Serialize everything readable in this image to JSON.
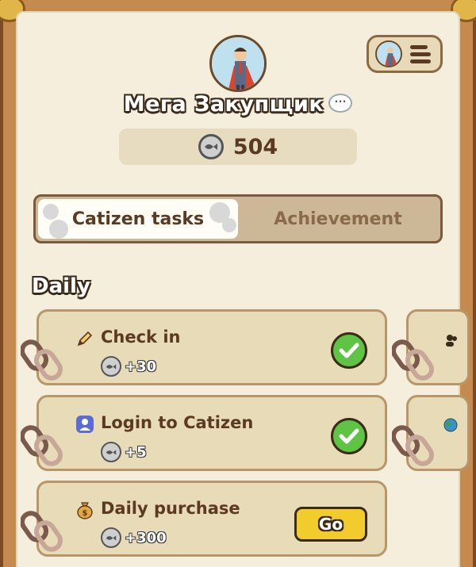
{
  "profile": {
    "username": "Мега Закупщик",
    "chat_glyph": "···",
    "balance": "504"
  },
  "tabs": [
    {
      "label": "Catizen tasks",
      "active": true
    },
    {
      "label": "Achievement",
      "active": false
    }
  ],
  "daily": {
    "title": "Daily",
    "tasks": [
      {
        "title": "Check in",
        "reward": "+30",
        "icon": "pencil-icon",
        "status": "done"
      },
      {
        "title": "Login to Catizen",
        "reward": "+5",
        "icon": "user-badge-icon",
        "status": "done"
      },
      {
        "title": "Daily purchase",
        "reward": "+300",
        "icon": "money-bag-icon",
        "status": "go",
        "button_label": "Go"
      }
    ]
  },
  "colors": {
    "panel": "#f5eedd",
    "card": "#e7dbb8",
    "text_brown": "#5a3a22",
    "check_green": "#5fc444",
    "go_yellow": "#f2cc2c"
  }
}
